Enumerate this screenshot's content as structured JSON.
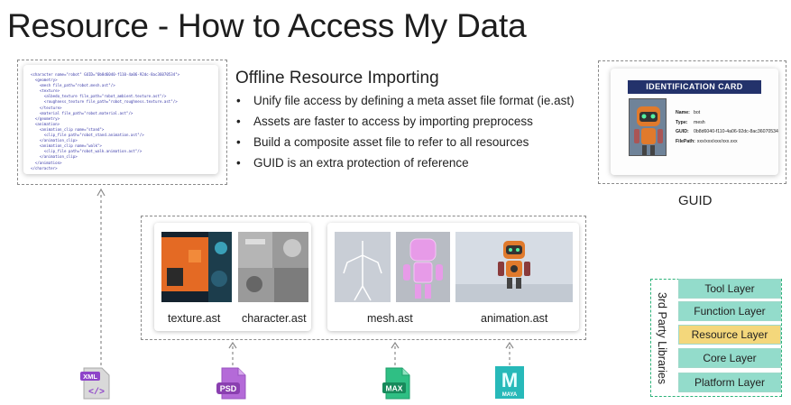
{
  "slide": {
    "title": "Resource - How to Access My Data"
  },
  "xml_snippet": {
    "lines": [
      "<character name=\"robot\" GUID=\"0b8d6040-f110-4a06-92dc-8ac36070534\">",
      "  <geometry>",
      "    <mesh file_path=\"robot.mesh.ast\"/>",
      "    <texture>",
      "      <albedo_texture file_path=\"robot_ambient.texture.ast\"/>",
      "      <roughness_texture file_path=\"robot_roughness.texture.ast\"/>",
      "    </texture>",
      "    <material file_path=\"robot.material.ast\"/>",
      "  </geometry>",
      "  <animation>",
      "    <animation_clip name=\"stand\">",
      "      <clip_file path=\"robot_stand.animation.ast\"/>",
      "    </animation_clip>",
      "    <animation_clip name=\"walk\">",
      "      <clip_file path=\"robot_walk.animation.ast\"/>",
      "    </animation_clip>",
      "  </animation>",
      "</character>"
    ]
  },
  "importing": {
    "heading": "Offline Resource Importing",
    "bullet_glyph": "•",
    "bullets": [
      "Unify file access by defining a meta asset file format (ie.ast)",
      "Assets are faster to access by importing preprocess",
      "Build a composite asset file to refer to all resources",
      "GUID is an extra protection of reference"
    ]
  },
  "id_card": {
    "header": "IDENTIFICATION CARD",
    "fields": [
      {
        "key": "Name:",
        "value": "bot"
      },
      {
        "key": "Type:",
        "value": "mesh"
      },
      {
        "key": "GUID:",
        "value": "0b8d6040-f110-4a06-92dc-8ac36070534"
      },
      {
        "key": "FilePath:",
        "value": "xxx/xxx/xxx/xxx.xxx"
      }
    ],
    "caption": "GUID"
  },
  "assets": {
    "labels": {
      "texture": "texture.ast",
      "character": "character.ast",
      "mesh": "mesh.ast",
      "animation": "animation.ast"
    }
  },
  "file_icons": {
    "xml": "XML",
    "psd": "PSD",
    "max": "MAX",
    "maya": "MAYA",
    "maya_letter": "M",
    "xml_glyph": "</>"
  },
  "engine_layers": {
    "third_party": "3rd Party Libraries",
    "layers": [
      "Tool Layer",
      "Function Layer",
      "Resource Layer",
      "Core Layer",
      "Platform Layer"
    ],
    "highlighted": "Resource Layer",
    "colors": {
      "default": "#93dccb",
      "highlight": "#f4d77b",
      "border": "#2db37a"
    }
  }
}
